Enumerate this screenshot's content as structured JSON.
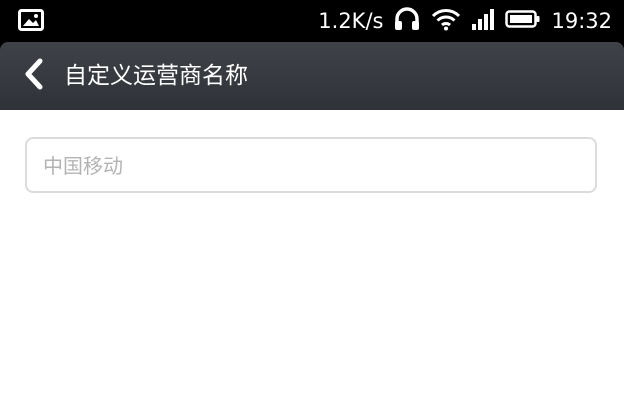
{
  "status_bar": {
    "notification_icon": "image-icon",
    "net_speed": "1.2K/s",
    "headset_icon": "headphones-icon",
    "wifi_icon": "wifi-icon",
    "signal_icon": "signal-icon",
    "battery_icon": "battery-icon",
    "time": "19:32"
  },
  "header": {
    "back_icon": "chevron-left-icon",
    "title": "自定义运营商名称"
  },
  "form": {
    "carrier_name_placeholder": "中国移动",
    "carrier_name_value": ""
  },
  "colors": {
    "status_bar_bg": "#000000",
    "title_bar_bg": "#35383d",
    "input_border": "#dcdcdc",
    "placeholder": "#b3b3b3"
  }
}
